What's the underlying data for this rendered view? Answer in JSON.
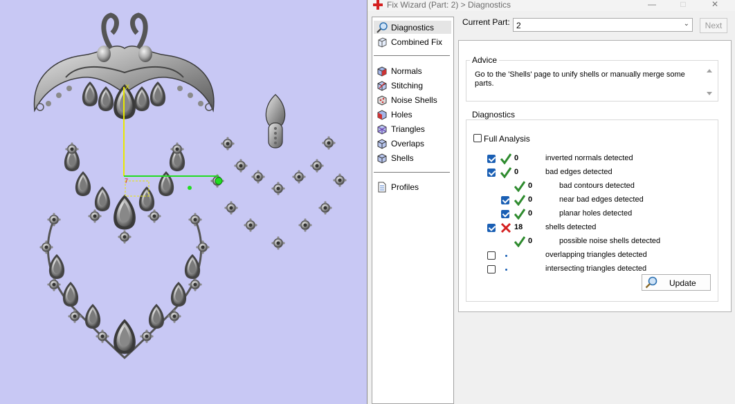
{
  "window": {
    "title": "Fix Wizard (Part: 2) > Diagnostics",
    "minimize": "—",
    "maximize": "□",
    "close": "✕"
  },
  "nav": {
    "items": [
      {
        "label": "Diagnostics",
        "icon": "magnifier-icon",
        "selected": true
      },
      {
        "label": "Combined Fix",
        "icon": "cube-icon"
      },
      {
        "label": "Normals",
        "icon": "cube-normals-icon"
      },
      {
        "label": "Stitching",
        "icon": "stitching-icon"
      },
      {
        "label": "Noise Shells",
        "icon": "noise-shells-icon"
      },
      {
        "label": "Holes",
        "icon": "holes-icon"
      },
      {
        "label": "Triangles",
        "icon": "triangles-icon"
      },
      {
        "label": "Overlaps",
        "icon": "overlaps-icon"
      },
      {
        "label": "Shells",
        "icon": "shells-icon"
      },
      {
        "label": "Profiles",
        "icon": "document-icon"
      }
    ]
  },
  "current_part": {
    "label": "Current Part:",
    "value": "2"
  },
  "next_label": "Next",
  "advice": {
    "title": "Advice",
    "text": "Go to the 'Shells' page to unify shells or manually merge some parts."
  },
  "diagnostics": {
    "title": "Diagnostics",
    "full_analysis_label": "Full Analysis",
    "full_analysis_checked": false,
    "rows": [
      {
        "checked": true,
        "status": "ok",
        "count": "0",
        "label": "inverted normals detected",
        "indent": 0
      },
      {
        "checked": true,
        "status": "ok",
        "count": "0",
        "label": "bad edges detected",
        "indent": 0
      },
      {
        "checked": null,
        "status": "ok",
        "count": "0",
        "label": "bad contours detected",
        "indent": 1
      },
      {
        "checked": true,
        "status": "ok",
        "count": "0",
        "label": "near bad edges detected",
        "indent": 1
      },
      {
        "checked": true,
        "status": "ok",
        "count": "0",
        "label": "planar holes detected",
        "indent": 1
      },
      {
        "checked": true,
        "status": "error",
        "count": "18",
        "label": "shells detected",
        "indent": 0
      },
      {
        "checked": null,
        "status": "ok",
        "count": "0",
        "label": "possible noise shells detected",
        "indent": 1
      },
      {
        "checked": false,
        "status": "pending",
        "count": "",
        "label": "overlapping triangles detected",
        "indent": 0
      },
      {
        "checked": false,
        "status": "pending",
        "count": "",
        "label": "intersecting triangles detected",
        "indent": 0
      }
    ]
  },
  "update_label": "Update",
  "colors": {
    "viewport_bg": "#c8c8f4",
    "check_green": "#2e8b2e",
    "error_red": "#d42020",
    "checkbox_blue": "#1a5fb4",
    "axis_yellow": "#e8e800",
    "axis_green": "#22dd22"
  }
}
